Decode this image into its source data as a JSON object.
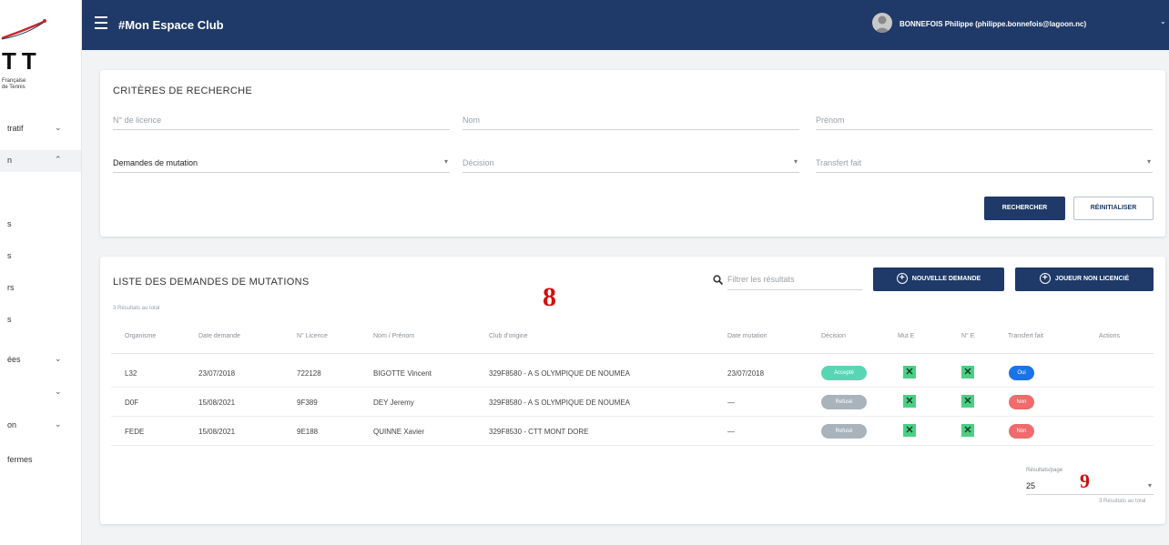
{
  "header": {
    "app_title": "#Mon Espace Club",
    "user_name": "BONNEFOIS Philippe (philippe.bonnefois@lagoon.nc)"
  },
  "sidebar": {
    "logo_text": "TT",
    "logo_sub1": "Française",
    "logo_sub2": "de Tennis",
    "items": [
      {
        "label": "tratif",
        "chevron": "⌄"
      },
      {
        "label": "n",
        "chevron": "⌃"
      },
      {
        "label": "",
        "chevron": ""
      },
      {
        "label": "s",
        "chevron": ""
      },
      {
        "label": "s",
        "chevron": ""
      },
      {
        "label": "rs",
        "chevron": ""
      },
      {
        "label": "s",
        "chevron": ""
      },
      {
        "label": "ées",
        "chevron": "⌄"
      },
      {
        "label": "",
        "chevron": "⌄"
      },
      {
        "label": "on",
        "chevron": "⌄"
      },
      {
        "label": "fermes",
        "chevron": ""
      }
    ]
  },
  "criteria": {
    "title": "CRITÈRES DE RECHERCHE",
    "license_placeholder": "N° de licence",
    "name_placeholder": "Nom",
    "firstname_placeholder": "Prénom",
    "type_value": "Demandes de mutation",
    "decision_placeholder": "Décision",
    "transfer_placeholder": "Transfert fait",
    "search_label": "RECHERCHER",
    "reset_label": "RÉINITIALISER"
  },
  "list": {
    "title": "LISTE DES DEMANDES DE MUTATIONS",
    "results_count": "3 Résultats au total",
    "filter_placeholder": "Filtrer les résultats",
    "new_request_label": "NOUVELLE DEMANDE",
    "unlicensed_label": "JOUEUR NON LICENCIÉ",
    "columns": [
      "Organisme",
      "Date demande",
      "N° Licence",
      "Nom / Prénom",
      "Club d'origine",
      "Date mutation",
      "Décision",
      "Mut E",
      "N° E",
      "Transfert fait",
      "Actions"
    ],
    "rows": [
      {
        "org": "L32",
        "date": "23/07/2018",
        "license": "722128",
        "name": "BIGOTTE Vincent",
        "club": "329F8580 - A S OLYMPIQUE DE NOUMEA",
        "mutation_date": "23/07/2018",
        "decision": "Accepté",
        "decision_color": "#58d6b4",
        "mut_e": "✕",
        "num_e": "✕",
        "transfer": "Oui",
        "transfer_color": "#1a73e8"
      },
      {
        "org": "D0F",
        "date": "15/08/2021",
        "license": "9F389",
        "name": "DEY Jeremy",
        "club": "329F8580 - A S OLYMPIQUE DE NOUMEA",
        "mutation_date": "—",
        "decision": "Refusé",
        "decision_color": "#a9b3bb",
        "mut_e": "✕",
        "num_e": "✕",
        "transfer": "Non",
        "transfer_color": "#f06b6b"
      },
      {
        "org": "FEDE",
        "date": "15/08/2021",
        "license": "9E188",
        "name": "QUINNE Xavier",
        "club": "329F8530 - CTT MONT DORE",
        "mutation_date": "—",
        "decision": "Refusé",
        "decision_color": "#a9b3bb",
        "mut_e": "✕",
        "num_e": "✕",
        "transfer": "Non",
        "transfer_color": "#f06b6b"
      }
    ],
    "per_page_label": "Résultats/page",
    "per_page_value": "25",
    "footer_count": "3 Résultats au total"
  },
  "annotations": {
    "eight": "8",
    "nine": "9"
  },
  "colors": {
    "primary": "#1f3a68"
  }
}
